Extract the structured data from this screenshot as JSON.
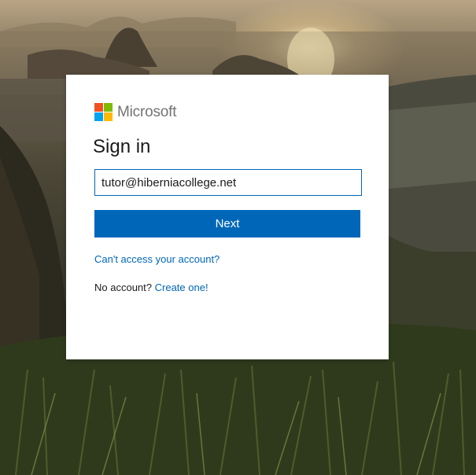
{
  "brand": {
    "name": "Microsoft",
    "logo_colors": [
      "#f25022",
      "#7fba00",
      "#00a4ef",
      "#ffb900"
    ]
  },
  "signin": {
    "title": "Sign in",
    "email_value": "tutor@hiberniacollege.net",
    "next_label": "Next",
    "cant_access_link": "Can't access your account?",
    "no_account_text": "No account?",
    "create_link": "Create one!"
  },
  "colors": {
    "accent": "#0067b8",
    "card_bg": "#ffffff"
  },
  "background": {
    "scene": "mountain-landscape-sunset"
  }
}
